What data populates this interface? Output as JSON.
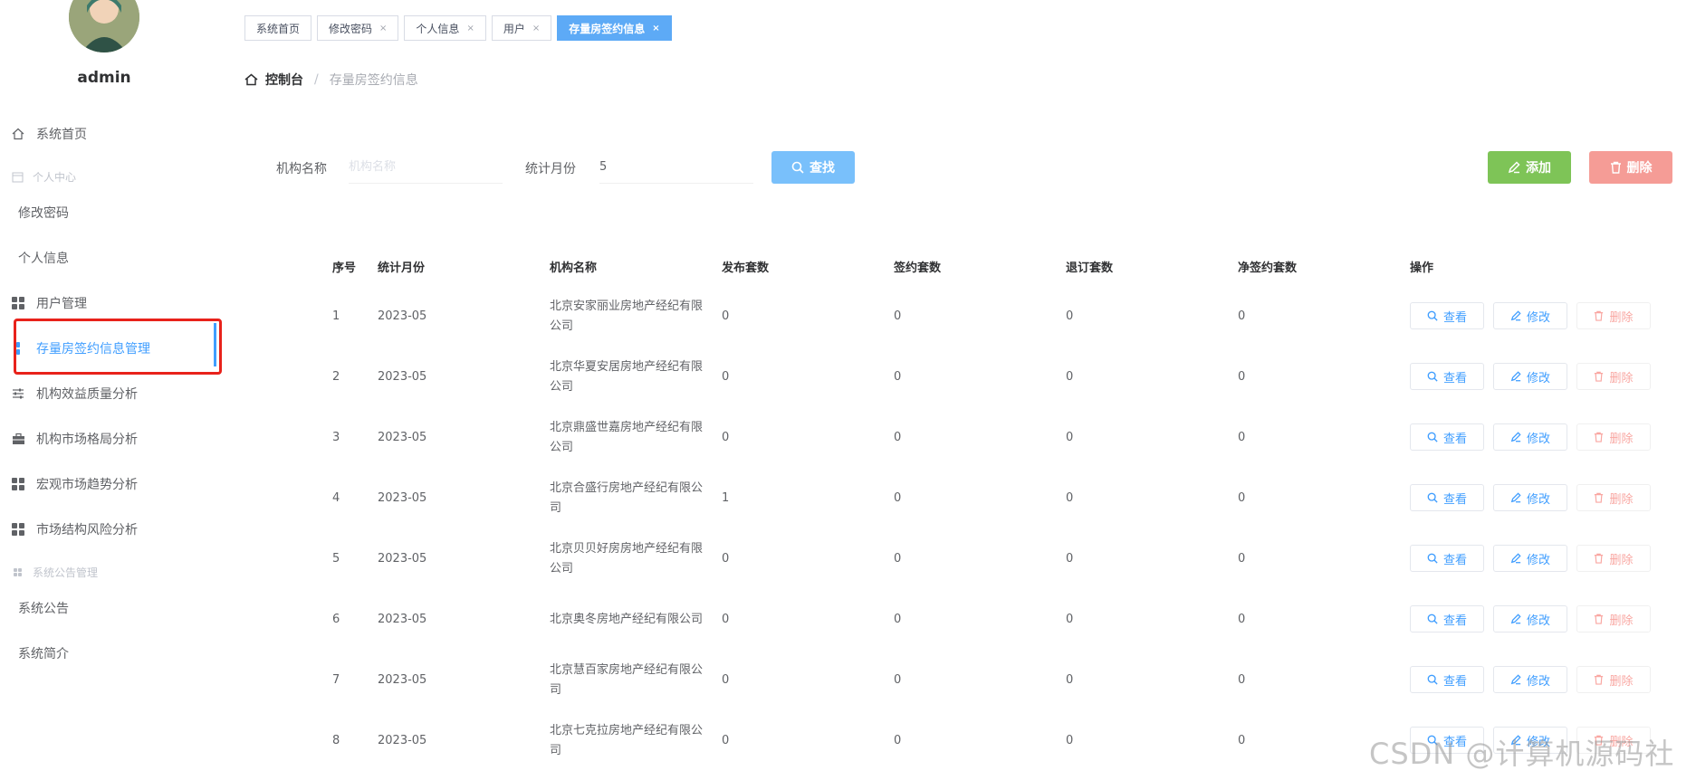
{
  "user": {
    "name": "admin"
  },
  "sidebar": {
    "items": [
      {
        "label": "系统首页",
        "icon": "home-icon"
      },
      {
        "label": "个人中心",
        "icon": "calendar-icon",
        "group": true
      },
      {
        "label": "修改密码"
      },
      {
        "label": "个人信息"
      },
      {
        "label": "用户管理",
        "icon": "grid-icon"
      },
      {
        "label": "存量房签约信息管理",
        "icon": "grid-icon",
        "active": true
      },
      {
        "label": "机构效益质量分析",
        "icon": "sliders-icon"
      },
      {
        "label": "机构市场格局分析",
        "icon": "briefcase-icon"
      },
      {
        "label": "宏观市场趋势分析",
        "icon": "grid-icon"
      },
      {
        "label": "市场结构风险分析",
        "icon": "grid-icon"
      },
      {
        "label": "系统公告管理",
        "icon": "grid-icon",
        "group": true
      },
      {
        "label": "系统公告"
      },
      {
        "label": "系统简介"
      }
    ]
  },
  "tabs": [
    {
      "label": "系统首页",
      "closable": false
    },
    {
      "label": "修改密码",
      "closable": true
    },
    {
      "label": "个人信息",
      "closable": true
    },
    {
      "label": "用户",
      "closable": true
    },
    {
      "label": "存量房签约信息",
      "closable": true,
      "active": true
    }
  ],
  "tab_close_glyph": "×",
  "breadcrumb": {
    "root": "控制台",
    "separator": "/",
    "current": "存量房签约信息"
  },
  "search": {
    "org_label": "机构名称",
    "org_placeholder": "机构名称",
    "org_value": "",
    "month_label": "统计月份",
    "month_value": "5",
    "find_button": "查找"
  },
  "toolbar": {
    "add_button": "添加",
    "delete_button": "删除"
  },
  "table": {
    "headers": [
      "序号",
      "统计月份",
      "机构名称",
      "发布套数",
      "签约套数",
      "退订套数",
      "净签约套数",
      "操作"
    ],
    "actions": {
      "view": "查看",
      "edit": "修改",
      "delete": "删除"
    },
    "rows": [
      {
        "no": "1",
        "month": "2023-05",
        "org": "北京安家丽业房地产经纪有限公司",
        "published": "0",
        "signed": "0",
        "cancelled": "0",
        "net": "0"
      },
      {
        "no": "2",
        "month": "2023-05",
        "org": "北京华夏安居房地产经纪有限公司",
        "published": "0",
        "signed": "0",
        "cancelled": "0",
        "net": "0"
      },
      {
        "no": "3",
        "month": "2023-05",
        "org": "北京鼎盛世嘉房地产经纪有限公司",
        "published": "0",
        "signed": "0",
        "cancelled": "0",
        "net": "0"
      },
      {
        "no": "4",
        "month": "2023-05",
        "org": "北京合盛行房地产经纪有限公司",
        "published": "1",
        "signed": "0",
        "cancelled": "0",
        "net": "0"
      },
      {
        "no": "5",
        "month": "2023-05",
        "org": "北京贝贝好房房地产经纪有限公司",
        "published": "0",
        "signed": "0",
        "cancelled": "0",
        "net": "0"
      },
      {
        "no": "6",
        "month": "2023-05",
        "org": "北京奥冬房地产经纪有限公司",
        "published": "0",
        "signed": "0",
        "cancelled": "0",
        "net": "0"
      },
      {
        "no": "7",
        "month": "2023-05",
        "org": "北京慧百家房地产经纪有限公司",
        "published": "0",
        "signed": "0",
        "cancelled": "0",
        "net": "0"
      },
      {
        "no": "8",
        "month": "2023-05",
        "org": "北京七克拉房地产经纪有限公司",
        "published": "0",
        "signed": "0",
        "cancelled": "0",
        "net": "0"
      }
    ]
  },
  "watermark": "CSDN @计算机源码社",
  "colors": {
    "primary": "#409eff",
    "add": "#7ec457",
    "danger": "#f59c96",
    "find": "#79c0fb",
    "highlight": "#e8221b"
  }
}
